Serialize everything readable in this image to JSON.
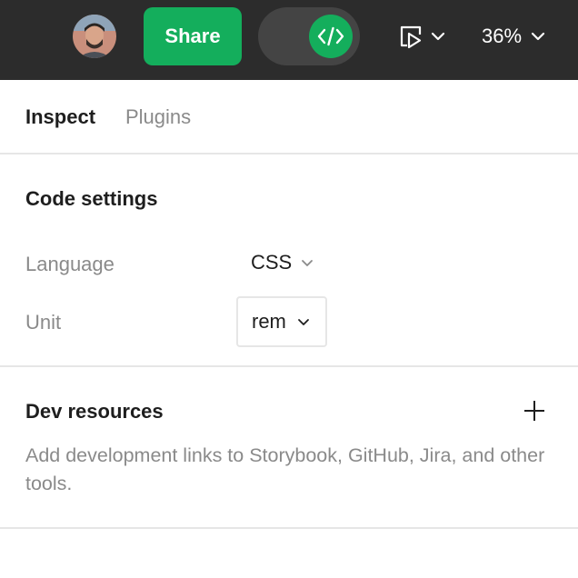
{
  "topbar": {
    "avatar_icon": "user-avatar",
    "share_label": "Share",
    "devmode_icon": "code-brackets-icon",
    "devmode_on": true,
    "present_icon": "present-play-icon",
    "zoom_label": "36%",
    "colors": {
      "bar_bg": "#2c2c2c",
      "accent": "#14ae5c"
    }
  },
  "tabs": {
    "inspect": "Inspect",
    "plugins": "Plugins",
    "active": "Inspect"
  },
  "code_settings": {
    "title": "Code settings",
    "language_label": "Language",
    "language_value": "CSS",
    "unit_label": "Unit",
    "unit_value": "rem"
  },
  "dev_resources": {
    "title": "Dev resources",
    "add_icon": "plus-icon",
    "description": "Add development links to Storybook, GitHub, Jira, and other tools."
  }
}
